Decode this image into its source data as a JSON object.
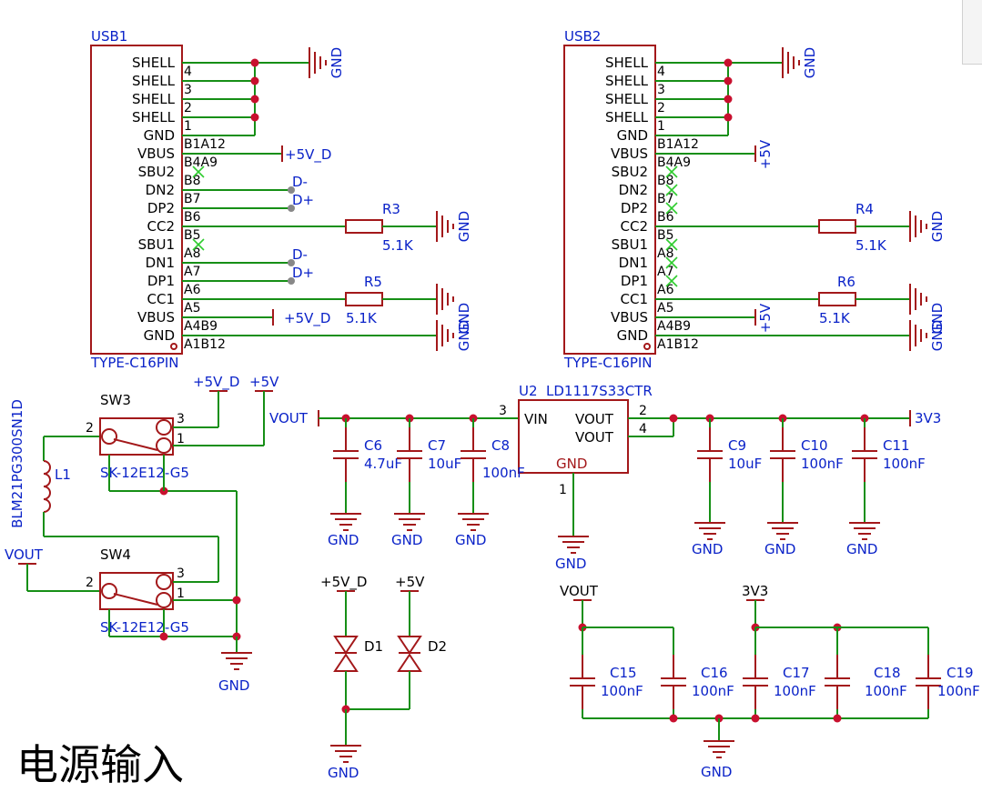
{
  "title": "电源输入",
  "usb": [
    {
      "ref": "USB1",
      "value": "TYPE-C16PIN",
      "pin_names": [
        "SHELL",
        "SHELL",
        "SHELL",
        "SHELL",
        "GND",
        "VBUS",
        "SBU2",
        "DN2",
        "DP2",
        "CC2",
        "SBU1",
        "DN1",
        "DP1",
        "CC1",
        "VBUS",
        "GND"
      ],
      "pin_numbers": [
        "4",
        "3",
        "2",
        "1",
        "B1A12",
        "B4A9",
        "B8",
        "B7",
        "B6",
        "B5",
        "A8",
        "A7",
        "A6",
        "A5",
        "A4B9",
        "A1B12"
      ],
      "nets": {
        "shell_gnd": "GND",
        "vbus_top": "+5V_D",
        "dn2": "D-",
        "dp2": "D+",
        "cc2_gnd": "GND",
        "dn1": "D-",
        "dp1": "D+",
        "vbus_bottom": "+5V_D",
        "cc1_gnd": "GND",
        "gnd_pin": "GND"
      },
      "r_cc2": {
        "ref": "R3",
        "value": "5.1K"
      },
      "r_cc1": {
        "ref": "R5",
        "value": "5.1K"
      }
    },
    {
      "ref": "USB2",
      "value": "TYPE-C16PIN",
      "pin_names": [
        "SHELL",
        "SHELL",
        "SHELL",
        "SHELL",
        "GND",
        "VBUS",
        "SBU2",
        "DN2",
        "DP2",
        "CC2",
        "SBU1",
        "DN1",
        "DP1",
        "CC1",
        "VBUS",
        "GND"
      ],
      "pin_numbers": [
        "4",
        "3",
        "2",
        "1",
        "B1A12",
        "B4A9",
        "B8",
        "B7",
        "B6",
        "B5",
        "A8",
        "A7",
        "A6",
        "A5",
        "A4B9",
        "A1B12"
      ],
      "nets": {
        "shell_gnd": "GND",
        "vbus_top": "+5V",
        "cc2_gnd": "GND",
        "vbus_bottom": "+5V",
        "cc1_gnd": "GND",
        "gnd_pin": "GND"
      },
      "r_cc2": {
        "ref": "R4",
        "value": "5.1K"
      },
      "r_cc1": {
        "ref": "R6",
        "value": "5.1K"
      }
    }
  ],
  "switches": [
    {
      "ref": "SW3",
      "value": "SK-12E12-G5",
      "pins": [
        "2",
        "3",
        "1"
      ]
    },
    {
      "ref": "SW4",
      "value": "SK-12E12-G5",
      "pins": [
        "2",
        "3",
        "1"
      ]
    }
  ],
  "inductor": {
    "ref": "L1",
    "value": "BLM21PG300SN1D"
  },
  "nets": {
    "p5vd": "+5V_D",
    "p5v": "+5V",
    "vout": "VOUT",
    "gnd": "GND",
    "v3v3": "3V3"
  },
  "regulator": {
    "ref": "U2",
    "value": "LD1117S33CTR",
    "pin_vin": "VIN",
    "pin_vout1": "VOUT",
    "pin_vout2": "VOUT",
    "pin_gnd": "GND",
    "num_vin": "3",
    "num_vout1": "2",
    "num_vout2": "4",
    "num_gnd": "1"
  },
  "caps_in": [
    {
      "ref": "C6",
      "value": "4.7uF"
    },
    {
      "ref": "C7",
      "value": "10uF"
    },
    {
      "ref": "C8",
      "value": "100nF"
    }
  ],
  "caps_out": [
    {
      "ref": "C9",
      "value": "10uF"
    },
    {
      "ref": "C10",
      "value": "100nF"
    },
    {
      "ref": "C11",
      "value": "100nF"
    }
  ],
  "diodes": [
    {
      "ref": "D1",
      "net": "+5V_D"
    },
    {
      "ref": "D2",
      "net": "+5V"
    }
  ],
  "decoupling": [
    {
      "ref": "C15",
      "value": "100nF"
    },
    {
      "ref": "C16",
      "value": "100nF"
    },
    {
      "ref": "C17",
      "value": "100nF"
    },
    {
      "ref": "C18",
      "value": "100nF"
    },
    {
      "ref": "C19",
      "value": "100nF"
    }
  ],
  "colors": {
    "wire": "#168f16",
    "component": "#a3181a",
    "net_label": "#0a22c8",
    "junction": "#c8102e",
    "no_connect": "#2fcc2f"
  }
}
